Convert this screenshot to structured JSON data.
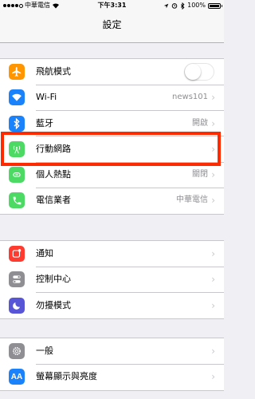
{
  "statusbar": {
    "carrier": "中華電信",
    "time": "下午3:31",
    "battery_percent": "100%",
    "battery_level": 1.0
  },
  "navbar": {
    "title": "設定"
  },
  "colors": {
    "orange": "#ff9500",
    "blue": "#1a82fb",
    "green": "#4cd964",
    "red": "#ff3b30",
    "gray": "#8e8e93",
    "purple": "#5856d6",
    "highlight": "#ff2a00"
  },
  "groups": [
    {
      "items": [
        {
          "label": "飛航模式",
          "icon": "airplane-icon",
          "control": "toggle",
          "on": false
        },
        {
          "label": "Wi-Fi",
          "icon": "wifi-icon",
          "value": "news101"
        },
        {
          "label": "藍牙",
          "icon": "bluetooth-icon",
          "value": "開啟"
        },
        {
          "label": "行動網路",
          "icon": "cellular-icon",
          "value": ""
        },
        {
          "label": "個人熱點",
          "icon": "hotspot-icon",
          "value": "關閉"
        },
        {
          "label": "電信業者",
          "icon": "phone-icon",
          "value": "中華電信"
        }
      ]
    },
    {
      "items": [
        {
          "label": "通知",
          "icon": "notifications-icon"
        },
        {
          "label": "控制中心",
          "icon": "control-center-icon"
        },
        {
          "label": "勿擾模式",
          "icon": "moon-icon"
        }
      ]
    },
    {
      "items": [
        {
          "label": "一般",
          "icon": "gear-icon"
        },
        {
          "label": "螢幕顯示與亮度",
          "icon": "display-icon"
        }
      ]
    }
  ]
}
